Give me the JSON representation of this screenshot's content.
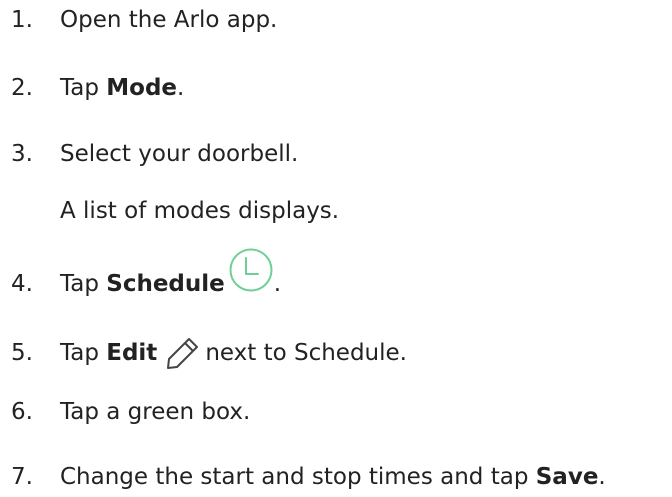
{
  "colors": {
    "text": "#222222",
    "clock_icon": "#6fcf97",
    "pencil_icon": "#444444"
  },
  "steps": [
    {
      "num": "1.",
      "text": "Open the Arlo app."
    },
    {
      "num": "2.",
      "pre": "Tap ",
      "bold": "Mode",
      "post": "."
    },
    {
      "num": "3.",
      "text": "Select your doorbell."
    },
    {
      "note": "A list of modes displays."
    },
    {
      "num": "4.",
      "pre": "Tap ",
      "bold": "Schedule",
      "post": ".",
      "icon": "clock-icon"
    },
    {
      "num": "5.",
      "pre": "Tap ",
      "bold": "Edit",
      "post": "next to Schedule.",
      "icon": "pencil-icon"
    },
    {
      "num": "6.",
      "text": "Tap a green box."
    },
    {
      "num": "7.",
      "pre": "Change the start and stop times and tap ",
      "bold": "Save",
      "post": "."
    }
  ]
}
